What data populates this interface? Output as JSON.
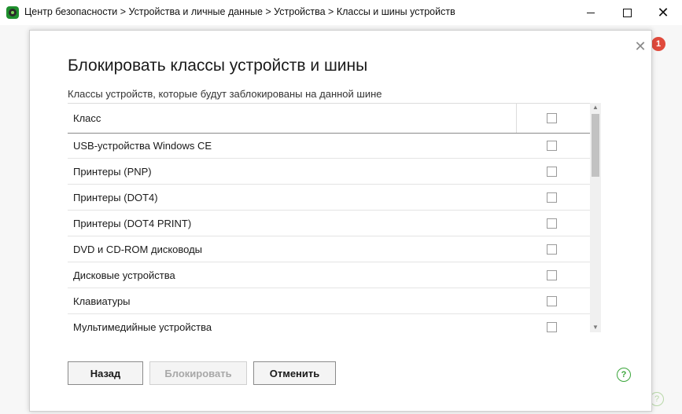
{
  "window": {
    "title": "Центр безопасности > Устройства и личные данные > Устройства > Классы и шины устройств",
    "icon": "shield-app-icon",
    "controls": {
      "close_glyph": "✕"
    }
  },
  "background": {
    "notification_count": "1",
    "help_glyph": "?"
  },
  "dialog": {
    "title": "Блокировать классы устройств и шины",
    "subtitle": "Классы устройств, которые будут заблокированы на данной шине",
    "close_glyph": "✕",
    "table": {
      "header": {
        "label": "Класс",
        "checked": false
      },
      "rows": [
        {
          "label": "USB-устройства Windows CE",
          "checked": false
        },
        {
          "label": "Принтеры (PNP)",
          "checked": false
        },
        {
          "label": "Принтеры (DOT4)",
          "checked": false
        },
        {
          "label": "Принтеры (DOT4 PRINT)",
          "checked": false
        },
        {
          "label": "DVD и CD-ROM дисководы",
          "checked": false
        },
        {
          "label": "Дисковые устройства",
          "checked": false
        },
        {
          "label": "Клавиатуры",
          "checked": false
        },
        {
          "label": "Мультимедийные устройства",
          "checked": false
        }
      ]
    },
    "buttons": {
      "back": "Назад",
      "block": "Блокировать",
      "cancel": "Отменить"
    },
    "help_glyph": "?"
  },
  "colors": {
    "accent_green": "#3aa53a",
    "badge_red": "#e04a3c",
    "disabled_text": "#a8a8a8"
  }
}
